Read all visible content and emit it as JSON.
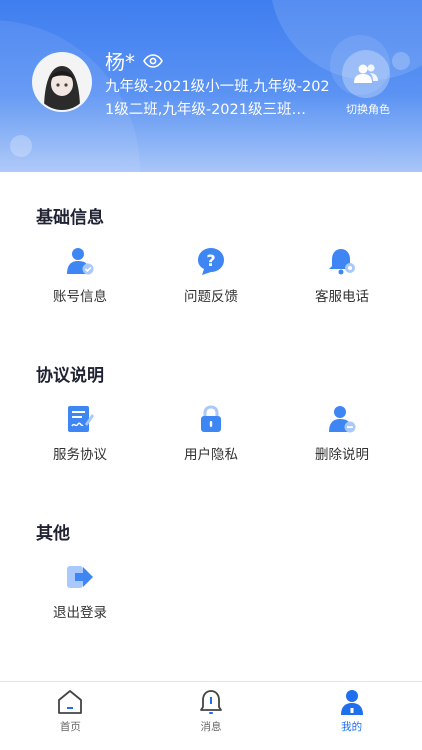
{
  "profile": {
    "name": "杨*",
    "classes": "九年级-2021级小一班,九年级-2021级二班,九年级-2021级三班…",
    "switch_role_label": "切换角色"
  },
  "sections": {
    "basic": {
      "title": "基础信息",
      "items": [
        {
          "label": "账号信息",
          "icon": "account-info-icon"
        },
        {
          "label": "问题反馈",
          "icon": "question-feedback-icon"
        },
        {
          "label": "客服电话",
          "icon": "customer-service-icon"
        }
      ]
    },
    "agreement": {
      "title": "协议说明",
      "items": [
        {
          "label": "服务协议",
          "icon": "service-agreement-icon"
        },
        {
          "label": "用户隐私",
          "icon": "privacy-lock-icon"
        },
        {
          "label": "删除说明",
          "icon": "delete-account-icon"
        }
      ]
    },
    "other": {
      "title": "其他",
      "items": [
        {
          "label": "退出登录",
          "icon": "logout-icon"
        }
      ]
    }
  },
  "tabbar": {
    "tabs": [
      {
        "label": "首页",
        "icon": "home-icon",
        "active": false
      },
      {
        "label": "消息",
        "icon": "bell-icon",
        "active": false
      },
      {
        "label": "我的",
        "icon": "profile-icon",
        "active": true
      }
    ]
  },
  "colors": {
    "header_start": "#3f7ef0",
    "header_end": "#a9c6f8",
    "icon_blue": "#3f86f5",
    "active_tab": "#1f6fee",
    "title": "#1f2233"
  }
}
